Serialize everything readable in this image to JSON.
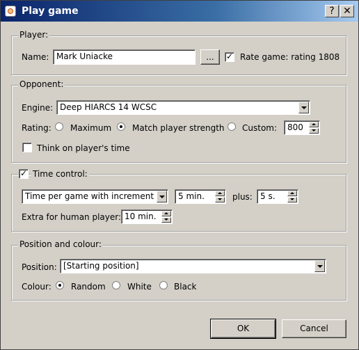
{
  "window": {
    "title": "Play game",
    "help_glyph": "?",
    "close_glyph": "✕"
  },
  "player": {
    "group_label": "Player:",
    "name_label": "Name:",
    "name_value": "Mark Uniacke",
    "browse_label": "...",
    "rate_checked": true,
    "rate_label": "Rate game: rating 1808"
  },
  "opponent": {
    "group_label": "Opponent:",
    "engine_label": "Engine:",
    "engine_value": "Deep HIARCS 14 WCSC",
    "rating_label": "Rating:",
    "rating_options": [
      "Maximum",
      "Match player strength",
      "Custom:"
    ],
    "rating_selected": "Match player strength",
    "custom_value": "800",
    "think_checked": false,
    "think_label": "Think on player's time"
  },
  "time": {
    "enabled": true,
    "group_label": "Time control:",
    "mode_value": "Time per game with increment",
    "minutes_value": "5 min.",
    "plus_label": "plus:",
    "seconds_value": "5 s.",
    "extra_label": "Extra for human player:",
    "extra_value": "10 min."
  },
  "position": {
    "group_label": "Position and colour:",
    "position_label": "Position:",
    "position_value": "[Starting position]",
    "colour_label": "Colour:",
    "colour_options": [
      "Random",
      "White",
      "Black"
    ],
    "colour_selected": "Random"
  },
  "buttons": {
    "ok": "OK",
    "cancel": "Cancel"
  },
  "checkmark": "✓"
}
